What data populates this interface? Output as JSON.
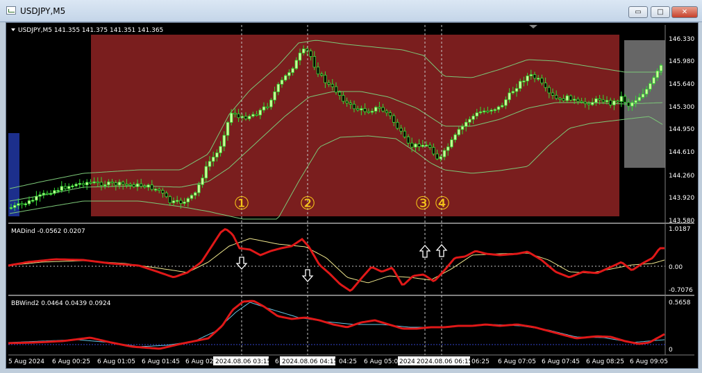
{
  "window": {
    "title": "USDJPY,M5",
    "minimize_glyph": "▭",
    "maximize_glyph": "□",
    "close_glyph": "✕"
  },
  "main_chart": {
    "header": "USDJPY,M5  141.355 141.375 141.351 141.365",
    "price_ticks": [
      "146.330",
      "145.980",
      "145.640",
      "145.300",
      "144.950",
      "144.610",
      "144.260",
      "143.920",
      "143.580"
    ],
    "markers": [
      "①",
      "②",
      "③",
      "④"
    ]
  },
  "madind_panel": {
    "header": "MADind -0.0562 0.0207",
    "ticks": [
      "1.0187",
      "0.00",
      "-0.7076"
    ]
  },
  "bbwind_panel": {
    "header": "BBWind2 0.0464 0.0439 0.0924",
    "ticks": [
      "0.5658",
      "0"
    ]
  },
  "time_axis": {
    "labels": [
      "5 Aug 2024",
      "6 Aug 00:25",
      "6 Aug 01:05",
      "6 Aug 01:45",
      "6 Aug 02:",
      "6 Aug",
      "04:25",
      "6 Aug 05:0",
      "06:25",
      "6 Aug 07:05",
      "6 Aug 07:45",
      "6 Aug 08:25",
      "6 Aug 09:05"
    ],
    "highlighted": [
      "2024.08.06 03:15",
      "2024.08.06 04:15",
      "2024",
      "2024.08.06 06:15"
    ]
  },
  "colors": {
    "background": "#000000",
    "box_red": "#7a1e1e",
    "box_gray": "#666666",
    "box_blue": "#1c2f8c",
    "bull_candle": "#ccff99",
    "bear_candle": "#000000",
    "candle_wick": "#33dd33",
    "band": "#7cc878",
    "mad_red": "#e01818",
    "mad_yellow": "#f0e68c",
    "bb_cyan": "#66c8e6",
    "marker_yellow": "#f5c518",
    "grid_dashed": "#c8c8c8",
    "divider": "#7f7f7f",
    "text": "#ffffff"
  }
}
